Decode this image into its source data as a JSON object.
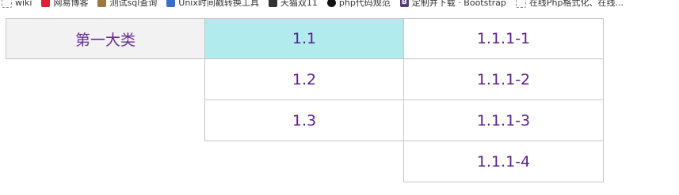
{
  "bookmarks": [
    {
      "icon": "page-icon",
      "label": "wiki"
    },
    {
      "icon": "netease-blog-icon",
      "label": "网易博客"
    },
    {
      "icon": "family-icon",
      "label": "测试sql查询"
    },
    {
      "icon": "unix-tool-icon",
      "label": "Unix时间戳转换工具"
    },
    {
      "icon": "tmall-icon",
      "label": "天猫双11"
    },
    {
      "icon": "github-icon",
      "label": "php代码规范"
    },
    {
      "icon": "bootstrap-icon",
      "label": "定制并下载 · Bootstrap"
    },
    {
      "icon": "page-icon",
      "label": "在线Php格式化、在线..."
    }
  ],
  "category": {
    "level1": "第一大类",
    "level2": [
      "1.1",
      "1.2",
      "1.3"
    ],
    "level3": [
      "1.1.1-1",
      "1.1.1-2",
      "1.1.1-3",
      "1.1.1-4"
    ]
  },
  "colors": {
    "text": "#5a1e8a",
    "selected_bg": "#b2ebee",
    "primary_bg": "#f2f2f2",
    "border": "#c6c6c6"
  }
}
